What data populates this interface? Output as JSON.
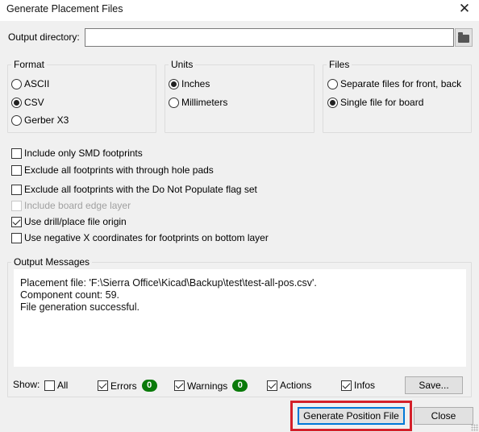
{
  "window": {
    "title": "Generate Placement Files",
    "close_icon": "close-icon"
  },
  "output_directory": {
    "label": "Output directory:",
    "value": "",
    "browse_icon": "folder-icon"
  },
  "format": {
    "legend": "Format",
    "options": [
      {
        "label": "ASCII",
        "selected": false
      },
      {
        "label": "CSV",
        "selected": true
      },
      {
        "label": "Gerber X3",
        "selected": false
      }
    ]
  },
  "units": {
    "legend": "Units",
    "options": [
      {
        "label": "Inches",
        "selected": true
      },
      {
        "label": "Millimeters",
        "selected": false
      }
    ]
  },
  "files": {
    "legend": "Files",
    "options": [
      {
        "label": "Separate files for front, back",
        "selected": false
      },
      {
        "label": "Single file for board",
        "selected": true
      }
    ]
  },
  "options": [
    {
      "label": "Include only SMD footprints",
      "checked": false,
      "enabled": true
    },
    {
      "label": "Exclude all footprints with through hole pads",
      "checked": false,
      "enabled": true
    },
    {
      "label": "Exclude all footprints with the Do Not Populate flag set",
      "checked": false,
      "enabled": true
    },
    {
      "label": "Include board edge layer",
      "checked": false,
      "enabled": false
    },
    {
      "label": "Use drill/place file origin",
      "checked": true,
      "enabled": true
    },
    {
      "label": "Use negative X coordinates for footprints on bottom layer",
      "checked": false,
      "enabled": true
    }
  ],
  "output_messages": {
    "legend": "Output Messages",
    "lines": [
      "Placement file: 'F:\\Sierra Office\\Kicad\\Backup\\test\\test-all-pos.csv'.",
      "Component count: 59.",
      "File generation successful."
    ]
  },
  "show_filters": {
    "label": "Show:",
    "all": {
      "label": "All",
      "checked": false
    },
    "errors": {
      "label": "Errors",
      "checked": true,
      "count": "0"
    },
    "warnings": {
      "label": "Warnings",
      "checked": true,
      "count": "0"
    },
    "actions": {
      "label": "Actions",
      "checked": true
    },
    "infos": {
      "label": "Infos",
      "checked": true
    },
    "badge_color": "#0a7a0a"
  },
  "buttons": {
    "save": "Save...",
    "generate": "Generate Position File",
    "close": "Close"
  },
  "highlight_color": "#d4202a"
}
